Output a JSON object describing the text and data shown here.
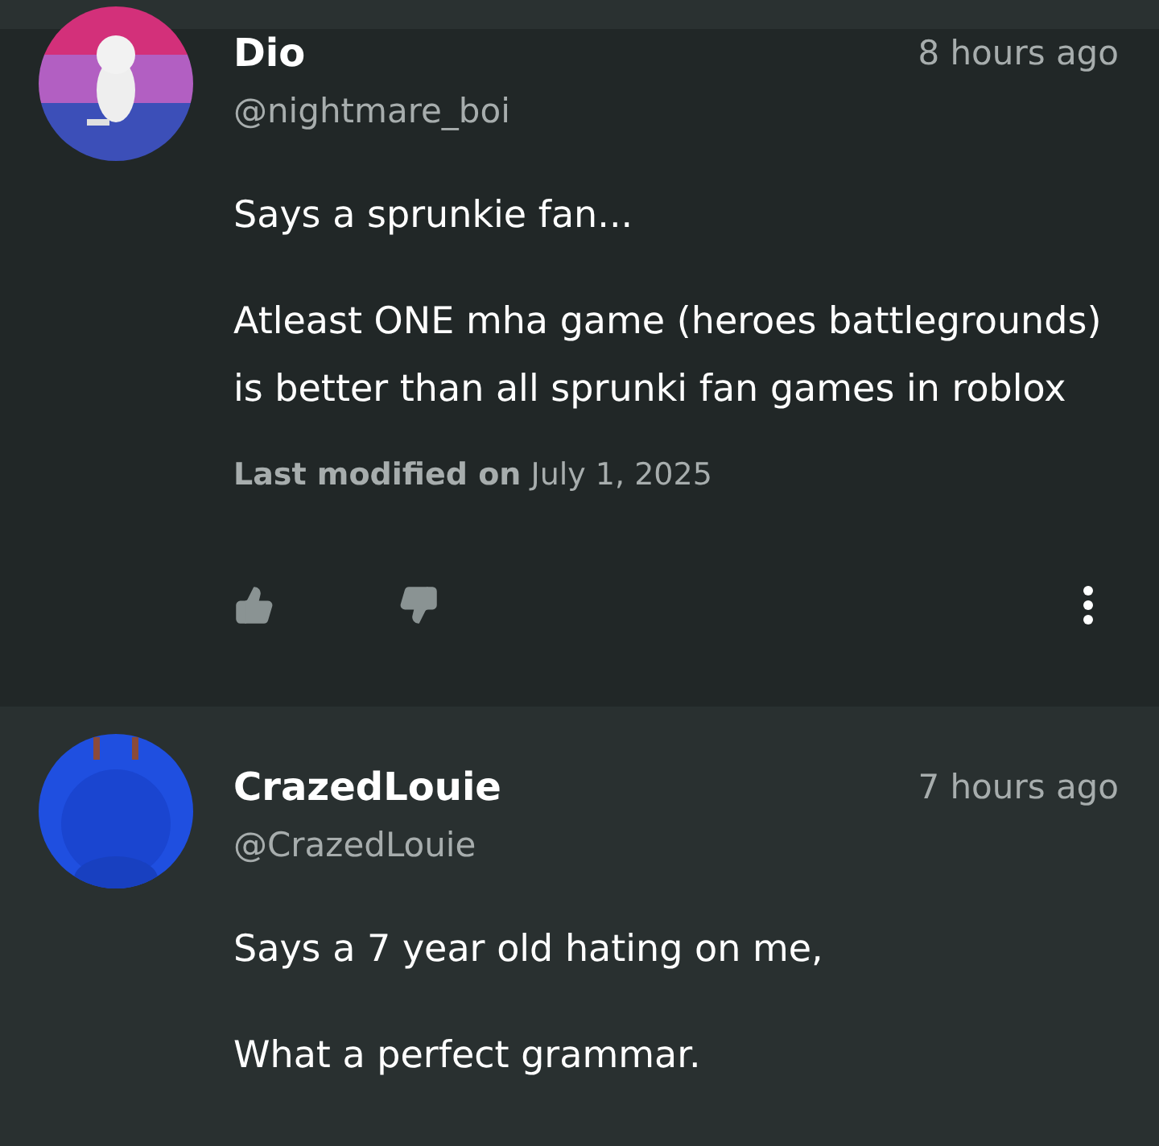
{
  "comments": [
    {
      "name": "Dio",
      "handle": "@nightmare_boi",
      "time": "8 hours ago",
      "paragraphs": [
        "Says a sprunkie fan...",
        "Atleast ONE mha game (heroes battlegrounds) is better than all sprunki fan games in roblox"
      ],
      "modified": "**Last modified on** July 1, 2025",
      "actions": true
    },
    {
      "name": "CrazedLouie",
      "handle": "@CrazedLouie",
      "time": "7 hours ago",
      "paragraphs": [
        "Says a 7 year old hating on me,",
        "What a perfect grammar."
      ],
      "actions": false
    }
  ]
}
